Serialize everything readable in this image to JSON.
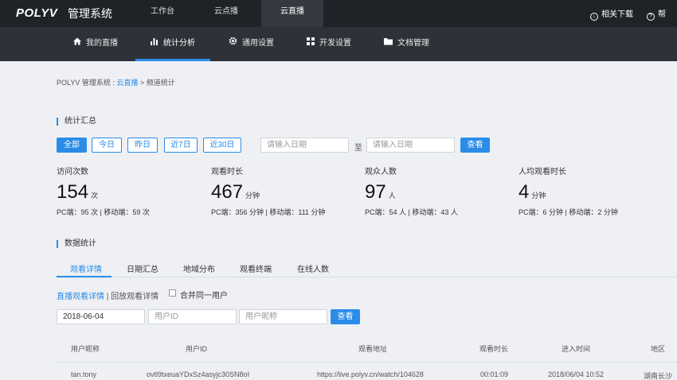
{
  "app": {
    "logo": "POLYV",
    "title": "管理系统"
  },
  "top_tabs": [
    "工作台",
    "云点播",
    "云直播"
  ],
  "top_right": {
    "download": "相关下载",
    "help": "帮"
  },
  "sub_tabs": [
    {
      "label": "我的直播",
      "icon": "home-icon"
    },
    {
      "label": "统计分析",
      "icon": "bar-chart-icon"
    },
    {
      "label": "通用设置",
      "icon": "gear-icon"
    },
    {
      "label": "开发设置",
      "icon": "grid-icon"
    },
    {
      "label": "文档管理",
      "icon": "folder-icon"
    }
  ],
  "breadcrumb": {
    "root": "POLYV 管理系统 :",
    "link": "云直播",
    "sep": ">",
    "current": "频道统计"
  },
  "summary": {
    "title": "统计汇总",
    "ranges": [
      "全部",
      "今日",
      "昨日",
      "近7日",
      "近30日"
    ],
    "start_placeholder": "请输入日期",
    "to": "至",
    "end_placeholder": "请输入日期",
    "search": "查看"
  },
  "stats": [
    {
      "label": "访问次数",
      "value": "154",
      "unit": "次",
      "detail": "PC端：95 次 | 移动端：59 次"
    },
    {
      "label": "观看时长",
      "value": "467",
      "unit": "分钟",
      "detail": "PC端：356 分钟 | 移动端：111 分钟"
    },
    {
      "label": "观众人数",
      "value": "97",
      "unit": "人",
      "detail": "PC端：54 人 | 移动端：43 人"
    },
    {
      "label": "人均观看时长",
      "value": "4",
      "unit": "分钟",
      "detail": "PC端：6 分钟 | 移动端：2 分钟"
    }
  ],
  "data_stats": {
    "title": "数据统计",
    "tabs": [
      "观看详情",
      "日期汇总",
      "地域分布",
      "观看终端",
      "在线人数"
    ],
    "link_live": "直播观看详情",
    "divider": "|",
    "link_replay": "回放观看详情",
    "merge_label": "合并同一用户",
    "date_value": "2018-06-04",
    "userid_placeholder": "用户ID",
    "nickname_placeholder": "用户昵称",
    "search": "查看"
  },
  "table": {
    "columns": [
      "用户昵称",
      "用户ID",
      "观看地址",
      "观看时长",
      "进入时间",
      "地区"
    ],
    "rows": [
      [
        "tan.tony",
        "ovtl9txeuaYDxSz4asyjc30SN8oI",
        "https://live.polyv.cn/watch/104628",
        "00:01:09",
        "2018/06/04 10:52",
        "湖南长沙"
      ]
    ]
  },
  "colors": {
    "accent": "#2b8ce8",
    "topbar": "#1f2227",
    "subbar": "#2e3238"
  }
}
